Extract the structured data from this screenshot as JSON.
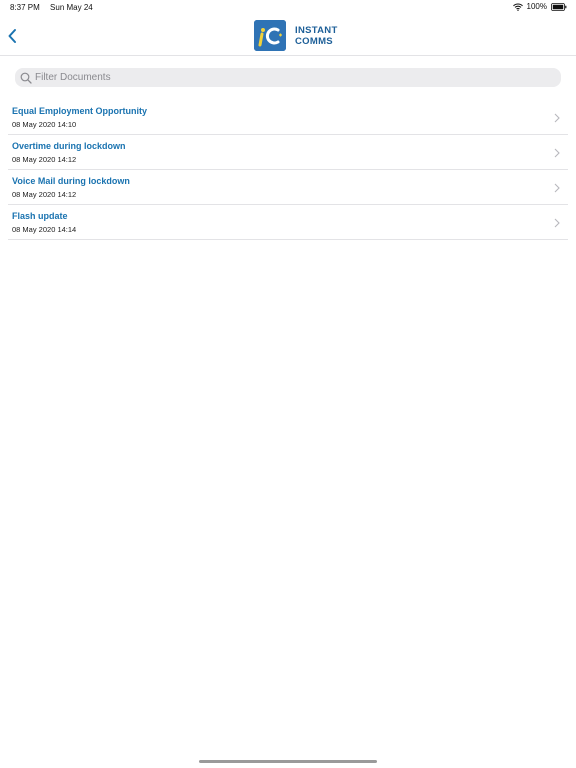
{
  "status_bar": {
    "time": "8:37 PM",
    "date": "Sun May 24",
    "battery": "100%"
  },
  "nav": {
    "back_icon": "chevron-left-icon",
    "logo": {
      "line1": "INSTANT",
      "line2": "COMMS",
      "brand_color": "#2f73b5"
    }
  },
  "search": {
    "placeholder": "Filter Documents",
    "value": ""
  },
  "documents": [
    {
      "title": "Equal Employment Opportunity",
      "date": "08 May 2020 14:10"
    },
    {
      "title": "Overtime during lockdown",
      "date": "08 May 2020 14:12"
    },
    {
      "title": "Voice Mail during lockdown",
      "date": "08 May 2020 14:12"
    },
    {
      "title": "Flash update",
      "date": "08 May 2020 14:14"
    }
  ],
  "colors": {
    "accent": "#1a73b0",
    "separator": "#e3e3e6",
    "search_bg": "#ececee"
  }
}
